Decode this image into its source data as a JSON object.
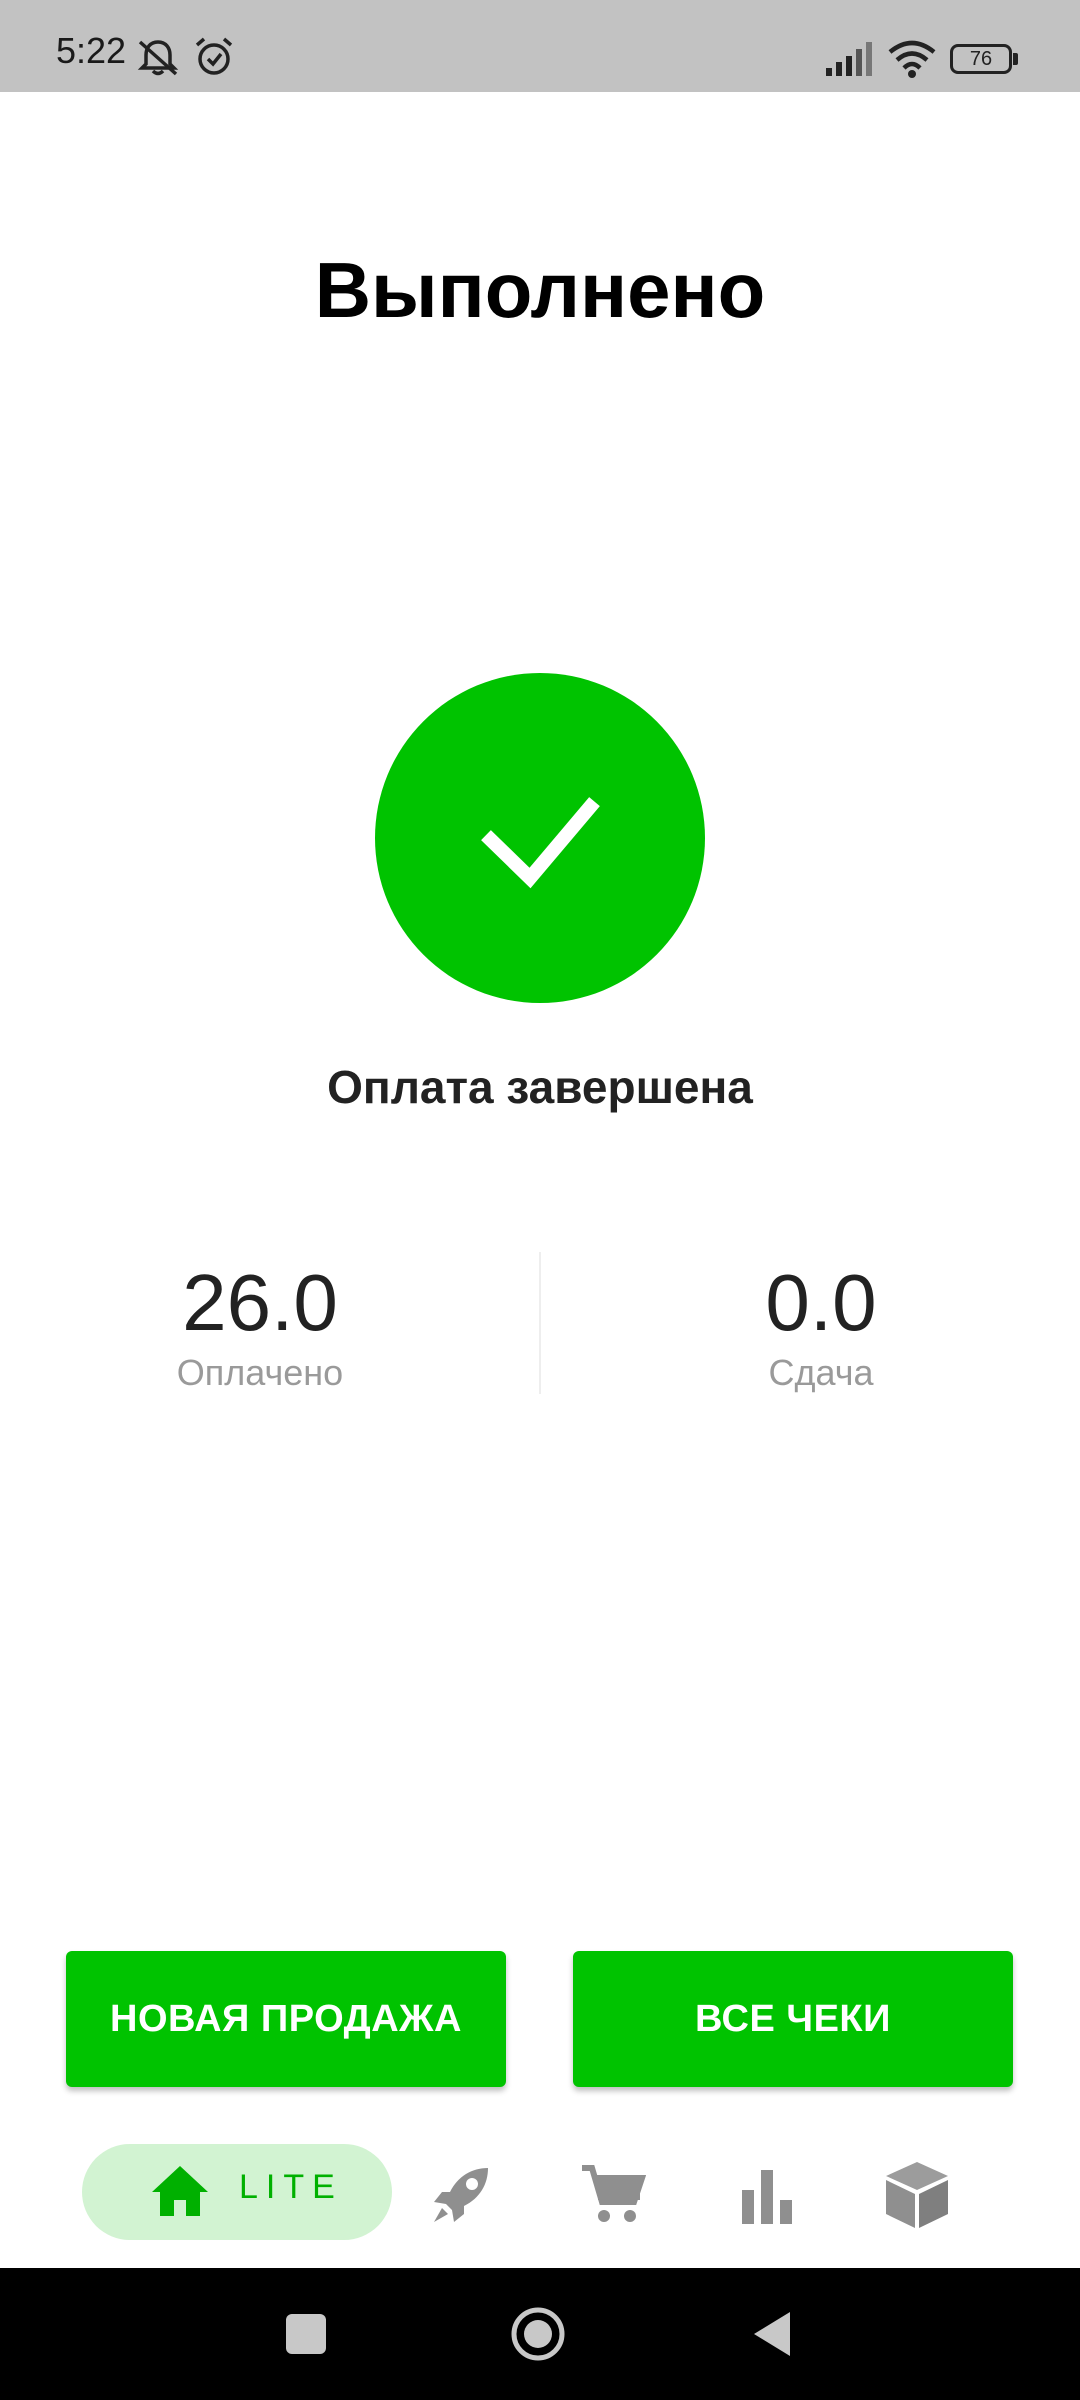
{
  "status_bar": {
    "time": "5:22",
    "battery": "76"
  },
  "screen": {
    "title": "Выполнено",
    "status": "Оплата завершена",
    "paid": {
      "value": "26.0",
      "label": "Оплачено"
    },
    "change": {
      "value": "0.0",
      "label": "Сдача"
    }
  },
  "actions": {
    "new_sale": "НОВАЯ ПРОДАЖА",
    "all_receipts": "ВСЕ ЧЕКИ"
  },
  "bottom_nav": {
    "active_label": "LITE",
    "items": [
      "home-icon",
      "rocket-icon",
      "cart-icon",
      "bar-chart-icon",
      "box-icon"
    ]
  },
  "colors": {
    "accent": "#00c300",
    "pill": "#d2f3d2",
    "nav_icon": "#8f8f8f"
  }
}
